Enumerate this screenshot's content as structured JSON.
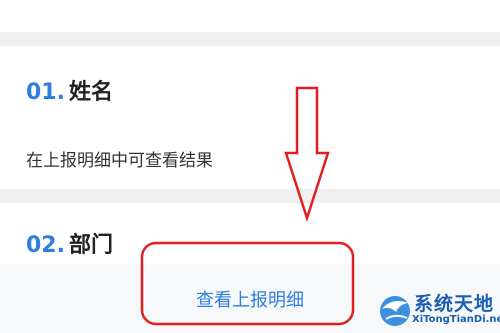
{
  "items": [
    {
      "number": "01.",
      "label": "姓名",
      "hint": "在上报明细中可查看结果"
    },
    {
      "number": "02.",
      "label": "部门"
    }
  ],
  "bottom_bar": {
    "view_details_label": "查看上报明细"
  },
  "annotations": {
    "arrow_color": "#e02020",
    "highlight_box_color": "#e02020"
  },
  "watermark": {
    "title": "系统天地",
    "subtitle": "XiTongTianDi.net"
  },
  "colors": {
    "accent": "#2e7de1",
    "background": "#f0f0f0",
    "card": "#ffffff"
  }
}
